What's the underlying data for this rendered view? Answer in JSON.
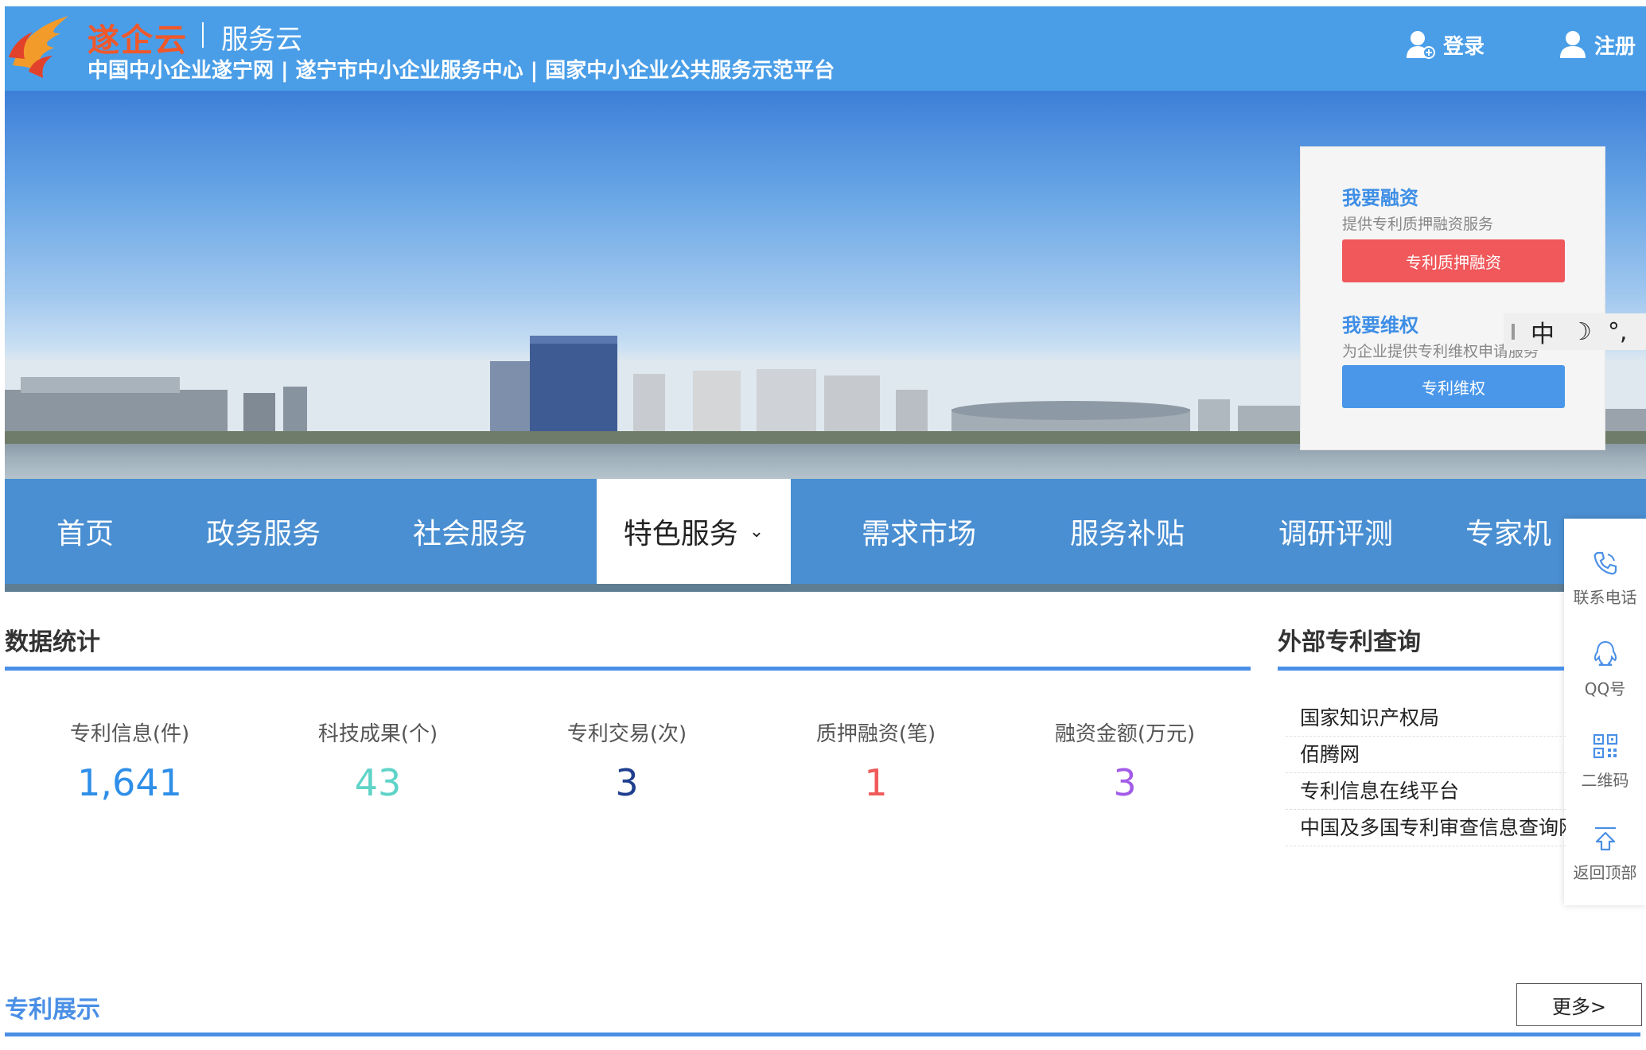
{
  "header": {
    "brand": "遂企云",
    "brand_sub": "服务云",
    "slogan": "中国中小企业遂宁网 | 遂宁市中小企业服务中心 | 国家中小企业公共服务示范平台",
    "login_label": "登录",
    "register_label": "注册"
  },
  "service_panel": {
    "financing_title": "我要融资",
    "financing_desc": "提供专利质押融资服务",
    "financing_button": "专利质押融资",
    "rights_title": "我要维权",
    "rights_desc": "为企业提供专利维权申请服务",
    "rights_button": "专利维权"
  },
  "ime": {
    "mode": "中",
    "moon": "☽",
    "punct": "°,"
  },
  "nav": {
    "items": [
      "首页",
      "政务服务",
      "社会服务",
      "特色服务",
      "需求市场",
      "服务补贴",
      "调研评测",
      "专家机"
    ],
    "active_index": 3
  },
  "float_bar": {
    "items": [
      "联系电话",
      "QQ号",
      "二维码",
      "返回顶部"
    ]
  },
  "stats": {
    "title": "数据统计",
    "items": [
      {
        "label": "专利信息(件)",
        "value": "1,641",
        "color": "#2f8fe8"
      },
      {
        "label": "科技成果(个)",
        "value": "43",
        "color": "#5fd3c8"
      },
      {
        "label": "专利交易(次)",
        "value": "3",
        "color": "#1f3f8f"
      },
      {
        "label": "质押融资(笔)",
        "value": "1",
        "color": "#f05a5a"
      },
      {
        "label": "融资金额(万元)",
        "value": "3",
        "color": "#a25ce8"
      }
    ]
  },
  "patent_query": {
    "title": "外部专利查询",
    "items": [
      "国家知识产权局",
      "佰腾网",
      "专利信息在线平台",
      "中国及多国专利审查信息查询网"
    ]
  },
  "patent_showcase": {
    "title": "专利展示",
    "more_label": "更多>"
  }
}
